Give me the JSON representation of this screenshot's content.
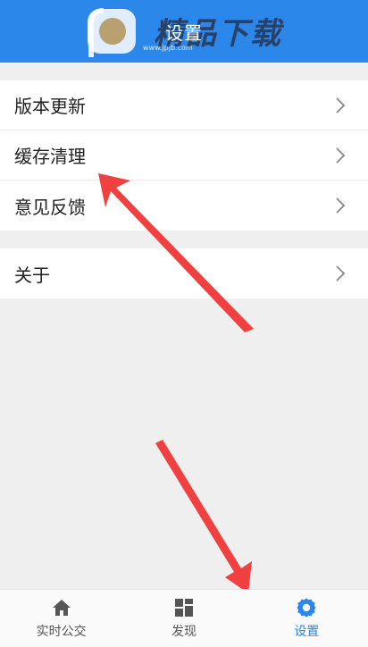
{
  "header": {
    "title": "设置"
  },
  "watermark": {
    "text": "精品下载",
    "url": "www.jpjb.com"
  },
  "groups": [
    {
      "items": [
        {
          "label": "版本更新"
        },
        {
          "label": "缓存清理"
        },
        {
          "label": "意见反馈"
        }
      ]
    },
    {
      "items": [
        {
          "label": "关于"
        }
      ]
    }
  ],
  "tabbar": {
    "tabs": [
      {
        "label": "实时公交",
        "icon": "home-icon"
      },
      {
        "label": "发现",
        "icon": "grid-icon"
      },
      {
        "label": "设置",
        "icon": "gear-icon",
        "active": true
      }
    ]
  },
  "colors": {
    "primary": "#2c87ea",
    "background": "#efefef",
    "annotation_arrow": "#f04040"
  }
}
